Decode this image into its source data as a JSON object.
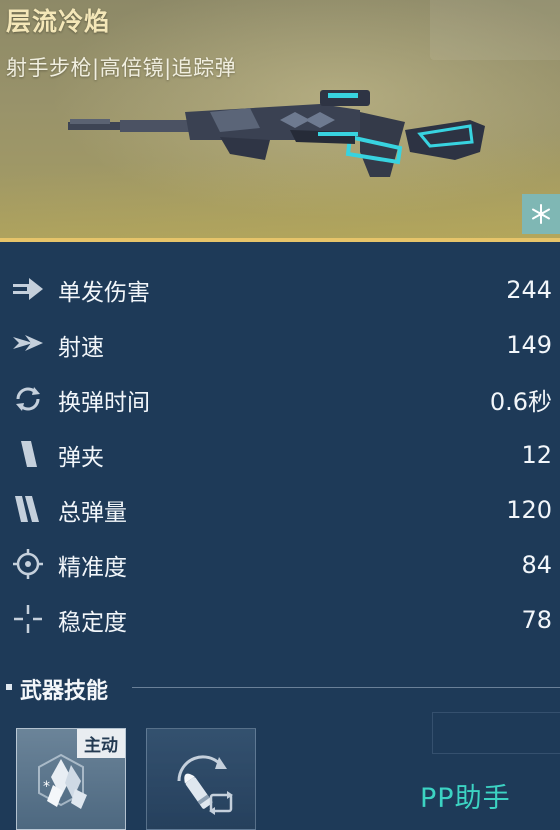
{
  "weapon": {
    "name": "层流冷焰",
    "tags": "射手步枪|高倍镜|追踪弹",
    "rarity_badge_icon": "snowflake-icon"
  },
  "colors": {
    "background": "#1e3a58",
    "accent": "#e6c46a",
    "title": "#f4e7b8",
    "weapon_glow": "#38d3e0",
    "watermark": "#3cd3c3"
  },
  "stats": [
    {
      "icon": "damage-arrow-icon",
      "label": "单发伤害",
      "value": "244"
    },
    {
      "icon": "fire-rate-icon",
      "label": "射速",
      "value": "149"
    },
    {
      "icon": "reload-icon",
      "label": "换弹时间",
      "value": "0.6秒"
    },
    {
      "icon": "magazine-icon",
      "label": "弹夹",
      "value": "12"
    },
    {
      "icon": "ammo-total-icon",
      "label": "总弹量",
      "value": "120"
    },
    {
      "icon": "crosshair-icon",
      "label": "精准度",
      "value": "84"
    },
    {
      "icon": "stability-icon",
      "label": "稳定度",
      "value": "78"
    }
  ],
  "skills": {
    "title": "武器技能",
    "cards": [
      {
        "icon": "ice-crystal-skill-icon",
        "tag": "主动"
      },
      {
        "icon": "bullet-swap-skill-icon"
      }
    ]
  },
  "watermark": "PP助手"
}
